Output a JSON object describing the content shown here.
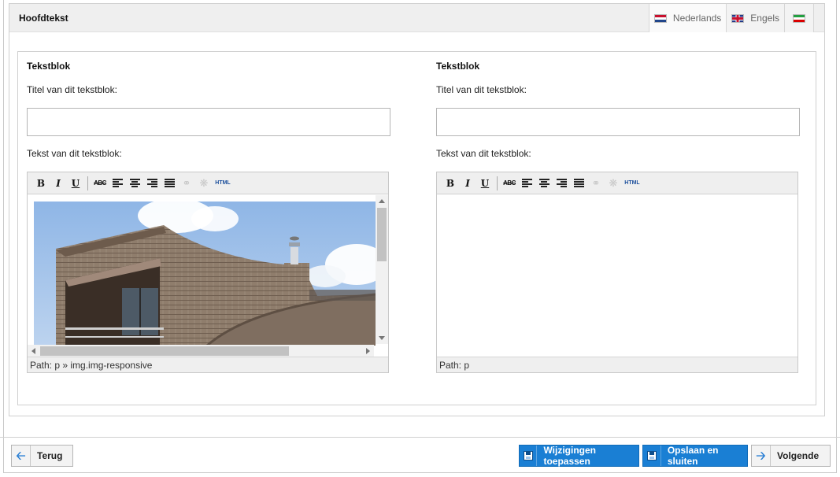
{
  "panel": {
    "title": "Hoofdtekst",
    "languages": [
      {
        "label": "Nederlands",
        "flag": "nl-flag-icon",
        "active": true
      },
      {
        "label": "Engels",
        "flag": "gb-flag-icon",
        "active": false
      },
      {
        "label": "",
        "flag": "ir-flag-icon",
        "active": false
      }
    ]
  },
  "blocks": [
    {
      "heading": "Tekstblok",
      "title_label": "Titel van dit tekstblok:",
      "title_value": "",
      "text_label": "Tekst van dit tekstblok:",
      "path": "Path: p » img.img-responsive",
      "has_image": true
    },
    {
      "heading": "Tekstblok",
      "title_label": "Titel van dit tekstblok:",
      "title_value": "",
      "text_label": "Tekst van dit tekstblok:",
      "path": "Path: p",
      "has_image": false
    }
  ],
  "toolbar": {
    "buttons": [
      "bold-icon",
      "italic-icon",
      "underline-icon",
      "spellcheck-icon",
      "align-left-icon",
      "align-center-icon",
      "align-right-icon",
      "align-justify-icon",
      "link-icon",
      "unlink-icon",
      "html-icon"
    ],
    "html_label": "HTML",
    "abc_label": "ABC"
  },
  "footer": {
    "back_label": "Terug",
    "apply_label": "Wijzigingen toepassen",
    "save_close_label": "Opslaan en sluiten",
    "next_label": "Volgende"
  },
  "colors": {
    "accent": "#1a7fd4",
    "panel_header": "#efefef",
    "border": "#cfcfcf"
  }
}
